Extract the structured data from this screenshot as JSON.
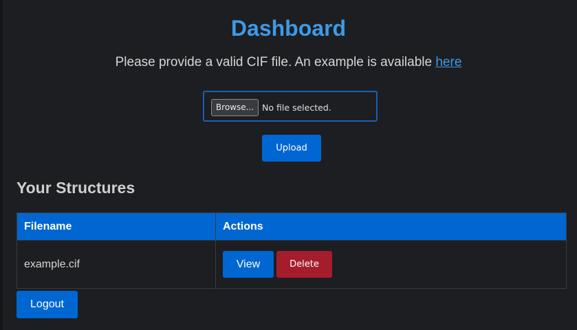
{
  "header": {
    "title": "Dashboard",
    "instructions": "Please provide a valid CIF file. An example is available ",
    "example_link": "here"
  },
  "upload": {
    "browse_label": "Browse...",
    "file_status": "No file selected.",
    "upload_label": "Upload"
  },
  "structures": {
    "heading": "Your Structures",
    "columns": [
      "Filename",
      "Actions"
    ],
    "rows": [
      {
        "filename": "example.cif",
        "view_label": "View",
        "delete_label": "Delete"
      }
    ]
  },
  "footer": {
    "logout_label": "Logout"
  },
  "colors": {
    "accent": "#0066d1",
    "title": "#3d9ae8",
    "danger": "#a51d2d",
    "background": "#1d1e21"
  }
}
